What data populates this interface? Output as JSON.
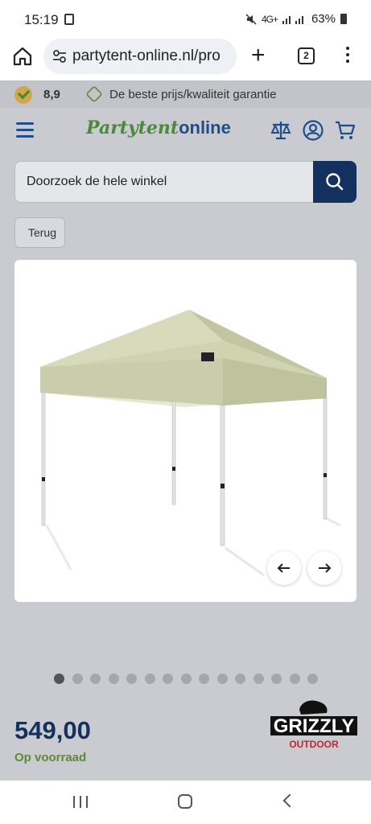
{
  "status_bar": {
    "time": "15:19",
    "network": "4G+",
    "battery": "63%"
  },
  "browser": {
    "url": "partytent-online.nl/pro",
    "tab_count": "2"
  },
  "top_bar": {
    "rating": "8,9",
    "guarantee": "De beste prijs/kwaliteit garantie"
  },
  "header": {
    "logo_part1": "Partytent",
    "logo_part2": "online"
  },
  "search": {
    "placeholder": "Doorzoek de hele winkel"
  },
  "back_label": "Terug",
  "gallery": {
    "total_images": 15,
    "active_index": 0
  },
  "product": {
    "price": "549,00",
    "stock": "Op voorraad",
    "brand_name": "GRIZZLY",
    "brand_sub": "OUTDOOR"
  },
  "colors": {
    "navy": "#12315e",
    "green": "#5c8a3a",
    "tent_canopy": "#cfd3b0"
  }
}
